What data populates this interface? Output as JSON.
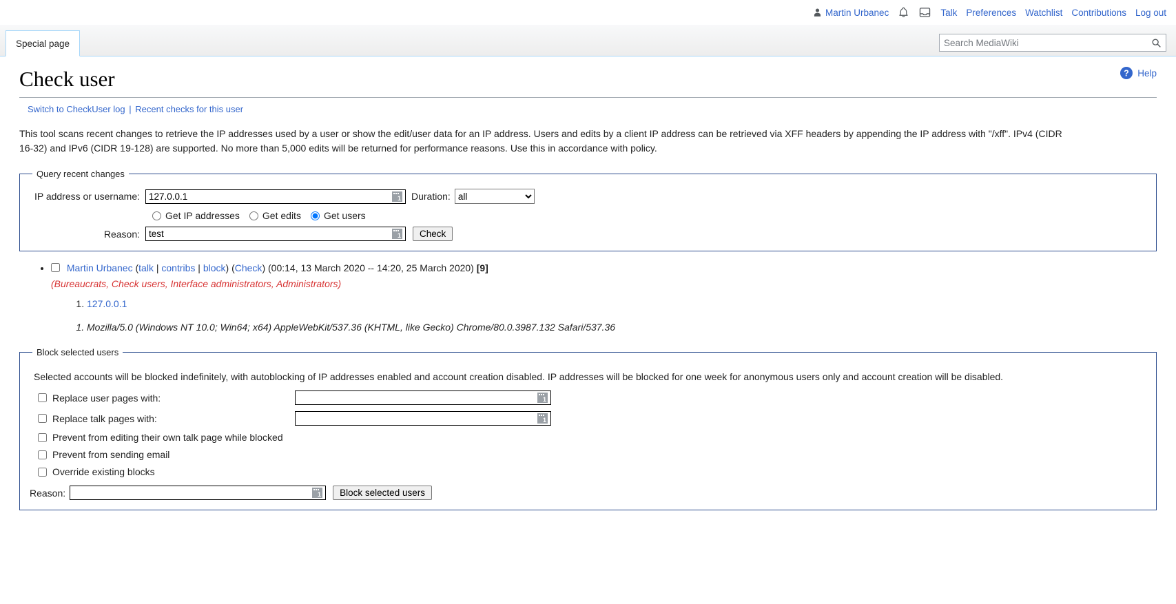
{
  "personal_bar": {
    "user_icon": "user-icon",
    "username": "Martin Urbanec",
    "alerts_icon": "bell-icon",
    "notices_icon": "tray-icon",
    "links": [
      "Talk",
      "Preferences",
      "Watchlist",
      "Contributions",
      "Log out"
    ]
  },
  "tabs": {
    "special_page": "Special page"
  },
  "search": {
    "placeholder": "Search MediaWiki",
    "value": "",
    "icon": "search-icon"
  },
  "help": {
    "icon": "help-icon",
    "label": "Help"
  },
  "page": {
    "title": "Check user",
    "subtitle_link_1": "Switch to CheckUser log",
    "subtitle_sep": "|",
    "subtitle_link_2": "Recent checks for this user",
    "intro": "This tool scans recent changes to retrieve the IP addresses used by a user or show the edit/user data for an IP address. Users and edits by a client IP address can be retrieved via XFF headers by appending the IP address with \"/xff\". IPv4 (CIDR 16-32) and IPv6 (CIDR 19-128) are supported. No more than 5,000 edits will be returned for performance reasons. Use this in accordance with policy."
  },
  "query_form": {
    "legend": "Query recent changes",
    "target_label": "IP address or username:",
    "target_value": "127.0.0.1",
    "target_placeholder": "",
    "duration_label": "Duration:",
    "duration_selected": "all",
    "duration_options": [
      "all"
    ],
    "radios": [
      {
        "label": "Get IP addresses",
        "checked": false
      },
      {
        "label": "Get edits",
        "checked": false
      },
      {
        "label": "Get users",
        "checked": true
      }
    ],
    "reason_label": "Reason:",
    "reason_value": "test",
    "check_button": "Check"
  },
  "results": {
    "user_name": "Martin Urbanec",
    "open_paren": "(",
    "talk_link": "talk",
    "pipe": "|",
    "contribs_link": "contribs",
    "block_link": "block",
    "close_paren": ")",
    "check_link": "Check",
    "date_range": "(00:14, 13 March 2020 -- 14:20, 25 March 2020)",
    "edit_count": "[9]",
    "groups": "(Bureaucrats, Check users, Interface administrators, Administrators)",
    "ip_addresses": [
      "127.0.0.1"
    ],
    "user_agents": [
      "Mozilla/5.0 (Windows NT 10.0; Win64; x64) AppleWebKit/537.36 (KHTML, like Gecko) Chrome/80.0.3987.132 Safari/537.36"
    ]
  },
  "block_form": {
    "legend": "Block selected users",
    "description": "Selected accounts will be blocked indefinitely, with autoblocking of IP addresses enabled and account creation disabled. IP addresses will be blocked for one week for anonymous users only and account creation will be disabled.",
    "options": [
      {
        "label": "Replace user pages with:",
        "checked": false,
        "has_input": true,
        "value": ""
      },
      {
        "label": "Replace talk pages with:",
        "checked": false,
        "has_input": true,
        "value": ""
      },
      {
        "label": "Prevent from editing their own talk page while blocked",
        "checked": false,
        "has_input": false
      },
      {
        "label": "Prevent from sending email",
        "checked": false,
        "has_input": false
      },
      {
        "label": "Override existing blocks",
        "checked": false,
        "has_input": false
      }
    ],
    "reason_label": "Reason:",
    "reason_value": "",
    "submit_button": "Block selected users"
  },
  "colors": {
    "link": "#3366cc",
    "border": "#2a4b8d",
    "group_text": "#d73333",
    "tab_border": "#a7d7f9"
  }
}
